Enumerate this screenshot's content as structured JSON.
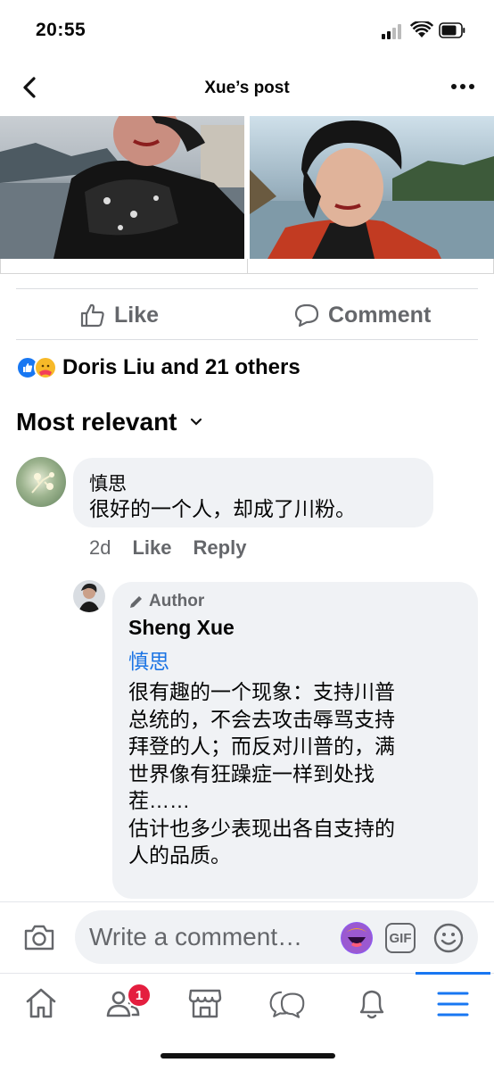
{
  "status_bar": {
    "time": "20:55"
  },
  "header": {
    "title": "Xue’s post"
  },
  "actions": {
    "like_label": "Like",
    "comment_label": "Comment"
  },
  "reactions": {
    "summary": "Doris Liu and 21 others"
  },
  "comments_sort": {
    "label": "Most relevant"
  },
  "comment": {
    "author": "慎思",
    "text": "很好的一个人，却成了川粉。",
    "time": "2d",
    "like_label": "Like",
    "reply_label": "Reply"
  },
  "reply": {
    "badge": "Author",
    "author": "Sheng Xue",
    "mention": "慎思",
    "lines": [
      "很有趣的一个现象：支持川普",
      "总统的，不会去攻击辱骂支持",
      "拜登的人；而反对川普的，满",
      "世界像有狂躁症一样到处找",
      "茬……",
      "估计也多少表现出各自支持的",
      "人的品质。"
    ]
  },
  "composer": {
    "placeholder": "Write a comment…",
    "gif_label": "GIF"
  },
  "tabbar": {
    "friends_badge": "1",
    "active_tab": "menu"
  },
  "colors": {
    "accent": "#1877f2",
    "mention": "#1b74e4",
    "badge": "#e41e3f",
    "bubble": "#f0f2f5"
  }
}
